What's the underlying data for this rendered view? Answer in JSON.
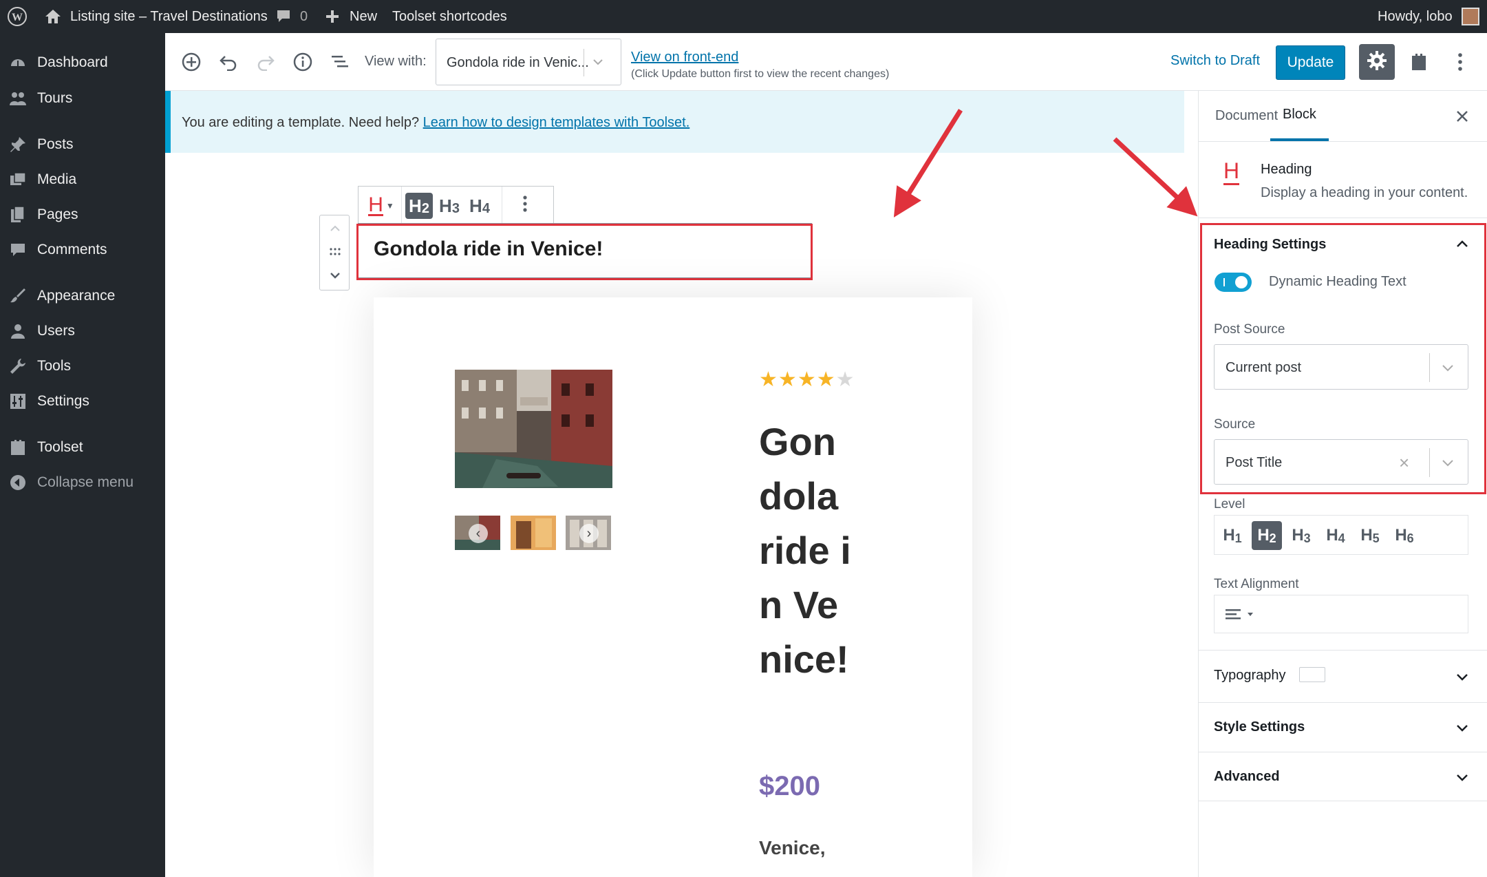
{
  "admin_bar": {
    "site_name": "Listing site – Travel Destinations",
    "comments_count": "0",
    "new_label": "New",
    "toolset_label": "Toolset shortcodes",
    "howdy": "Howdy, lobo"
  },
  "sidebar": {
    "items": [
      {
        "label": "Dashboard",
        "icon": "dashboard-icon"
      },
      {
        "label": "Tours",
        "icon": "tours-icon"
      },
      {
        "label": "Posts",
        "icon": "pushpin-icon"
      },
      {
        "label": "Media",
        "icon": "media-icon"
      },
      {
        "label": "Pages",
        "icon": "pages-icon"
      },
      {
        "label": "Comments",
        "icon": "comment-icon"
      },
      {
        "label": "Appearance",
        "icon": "paintbrush-icon"
      },
      {
        "label": "Users",
        "icon": "user-icon"
      },
      {
        "label": "Tools",
        "icon": "wrench-icon"
      },
      {
        "label": "Settings",
        "icon": "settings-sliders-icon"
      },
      {
        "label": "Toolset",
        "icon": "toolset-icon"
      },
      {
        "label": "Collapse menu",
        "icon": "collapse-icon"
      }
    ]
  },
  "editor_header": {
    "view_with_label": "View with:",
    "view_with_value": "Gondola ride in Venic...",
    "view_frontend": "View on front-end",
    "view_frontend_note": "(Click Update button first to view the recent changes)",
    "switch_to_draft": "Switch to Draft",
    "update": "Update"
  },
  "notice": {
    "text": "You are editing a template. Need help?",
    "link": "Learn how to design templates with Toolset."
  },
  "block_toolbar": {
    "levels": [
      {
        "letter": "H",
        "num": "2",
        "active": true
      },
      {
        "letter": "H",
        "num": "3",
        "active": false
      },
      {
        "letter": "H",
        "num": "4",
        "active": false
      }
    ]
  },
  "heading_block": {
    "text": "Gondola ride in Venice!"
  },
  "card": {
    "rating": 4,
    "rating_max": 5,
    "title": "Gondola ride in Venice!",
    "price": "$200",
    "location": "Venice,"
  },
  "settings_panel": {
    "tabs": [
      "Document",
      "Block"
    ],
    "active_tab": "Block",
    "block_name": "Heading",
    "block_desc": "Display a heading in your content.",
    "heading_settings": {
      "title": "Heading Settings",
      "toggle_label": "Dynamic Heading Text",
      "toggle_on": true,
      "post_source_label": "Post Source",
      "post_source_value": "Current post",
      "source_label": "Source",
      "source_value": "Post Title"
    },
    "level_label": "Level",
    "levels": [
      {
        "letter": "H",
        "num": "1",
        "active": false
      },
      {
        "letter": "H",
        "num": "2",
        "active": true
      },
      {
        "letter": "H",
        "num": "3",
        "active": false
      },
      {
        "letter": "H",
        "num": "4",
        "active": false
      },
      {
        "letter": "H",
        "num": "5",
        "active": false
      },
      {
        "letter": "H",
        "num": "6",
        "active": false
      }
    ],
    "text_alignment_label": "Text Alignment",
    "panels": [
      "Typography",
      "Style Settings",
      "Advanced"
    ]
  },
  "colors": {
    "admin_bg": "#23282d",
    "accent_blue": "#0085ba",
    "link_blue": "#0073aa",
    "highlight_red": "#e0323c",
    "price_purple": "#7b6ab1",
    "star_gold": "#f7b426"
  }
}
